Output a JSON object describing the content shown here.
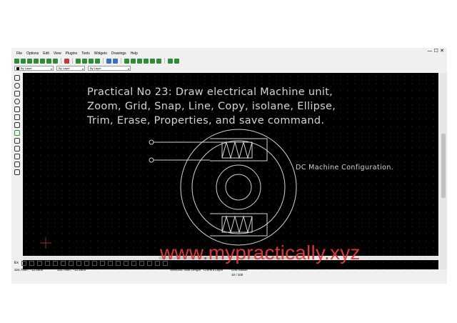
{
  "app": {
    "window_controls": "—  ☐  ✕",
    "menu": [
      "File",
      "Options",
      "Edit",
      "View",
      "Plugins",
      "Tools",
      "Widgets",
      "Drawings",
      "Help"
    ],
    "property_combos": [
      "By Layer",
      "By Layer",
      "By Layer"
    ],
    "snap_label": "Ex",
    "status": {
      "coord_abs": "324.7500 , -12.2500",
      "coord_rel": "324.7500 , -12.2500",
      "selected_label": "Selected Total Length",
      "layer_label": "Current Layer",
      "grid_label": "Grid Status",
      "grid_value": "10 / 100"
    }
  },
  "drawing": {
    "title_lines": [
      "Practical No 23: Draw electrical Machine unit,",
      "Zoom, Grid, Snap, Line, Copy, isolane, Ellipse,",
      "Trim, Erase, Properties, and save command."
    ],
    "label": "DC Machine Configuration."
  },
  "watermark": "www.mypractically.xyz",
  "colors": {
    "canvas_bg": "#000000",
    "drawing_line": "#d4d4d4",
    "watermark": "#e83a3a",
    "ui_bg": "#f0f0f0"
  }
}
